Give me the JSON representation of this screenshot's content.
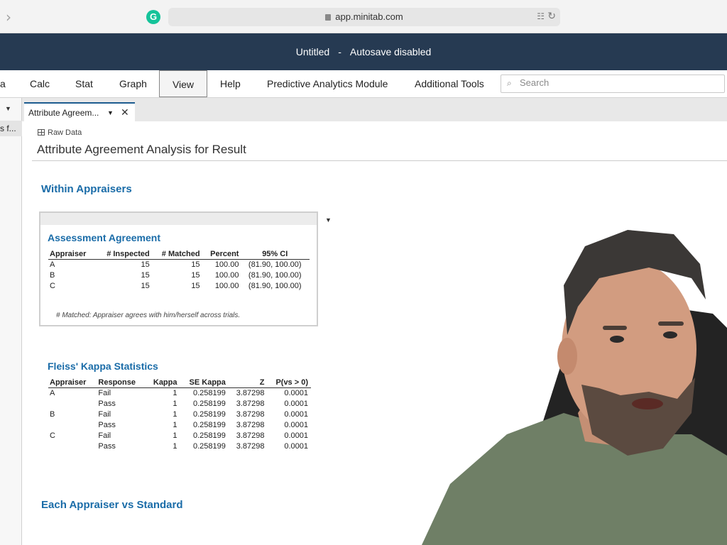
{
  "browser": {
    "url": "app.minitab.com"
  },
  "titlebar": {
    "title": "Untitled",
    "separator": "-",
    "status": "Autosave disabled"
  },
  "menu": {
    "items": [
      {
        "label": "a"
      },
      {
        "label": "Calc"
      },
      {
        "label": "Stat"
      },
      {
        "label": "Graph"
      },
      {
        "label": "View"
      },
      {
        "label": "Help"
      },
      {
        "label": "Predictive Analytics Module"
      },
      {
        "label": "Additional Tools"
      }
    ],
    "search_placeholder": "Search"
  },
  "left_panel": {
    "item_label": "s f..."
  },
  "tab": {
    "label": "Attribute Agreem..."
  },
  "content": {
    "raw_data_label": "Raw Data",
    "title": "Attribute Agreement Analysis for Result",
    "within_heading": "Within Appraisers",
    "assessment": {
      "heading": "Assessment Agreement",
      "columns": [
        "Appraiser",
        "# Inspected",
        "# Matched",
        "Percent",
        "95% CI"
      ],
      "rows": [
        [
          "A",
          "15",
          "15",
          "100.00",
          "(81.90, 100.00)"
        ],
        [
          "B",
          "15",
          "15",
          "100.00",
          "(81.90, 100.00)"
        ],
        [
          "C",
          "15",
          "15",
          "100.00",
          "(81.90, 100.00)"
        ]
      ],
      "footnote": "# Matched: Appraiser agrees with him/herself across trials."
    },
    "kappa": {
      "heading": "Fleiss' Kappa Statistics",
      "columns": [
        "Appraiser",
        "Response",
        "Kappa",
        "SE Kappa",
        "Z",
        "P(vs > 0)"
      ],
      "rows": [
        [
          "A",
          "Fail",
          "1",
          "0.258199",
          "3.87298",
          "0.0001"
        ],
        [
          "",
          "Pass",
          "1",
          "0.258199",
          "3.87298",
          "0.0001"
        ],
        [
          "B",
          "Fail",
          "1",
          "0.258199",
          "3.87298",
          "0.0001"
        ],
        [
          "",
          "Pass",
          "1",
          "0.258199",
          "3.87298",
          "0.0001"
        ],
        [
          "C",
          "Fail",
          "1",
          "0.258199",
          "3.87298",
          "0.0001"
        ],
        [
          "",
          "Pass",
          "1",
          "0.258199",
          "3.87298",
          "0.0001"
        ]
      ]
    },
    "standard_heading": "Each Appraiser vs Standard"
  }
}
